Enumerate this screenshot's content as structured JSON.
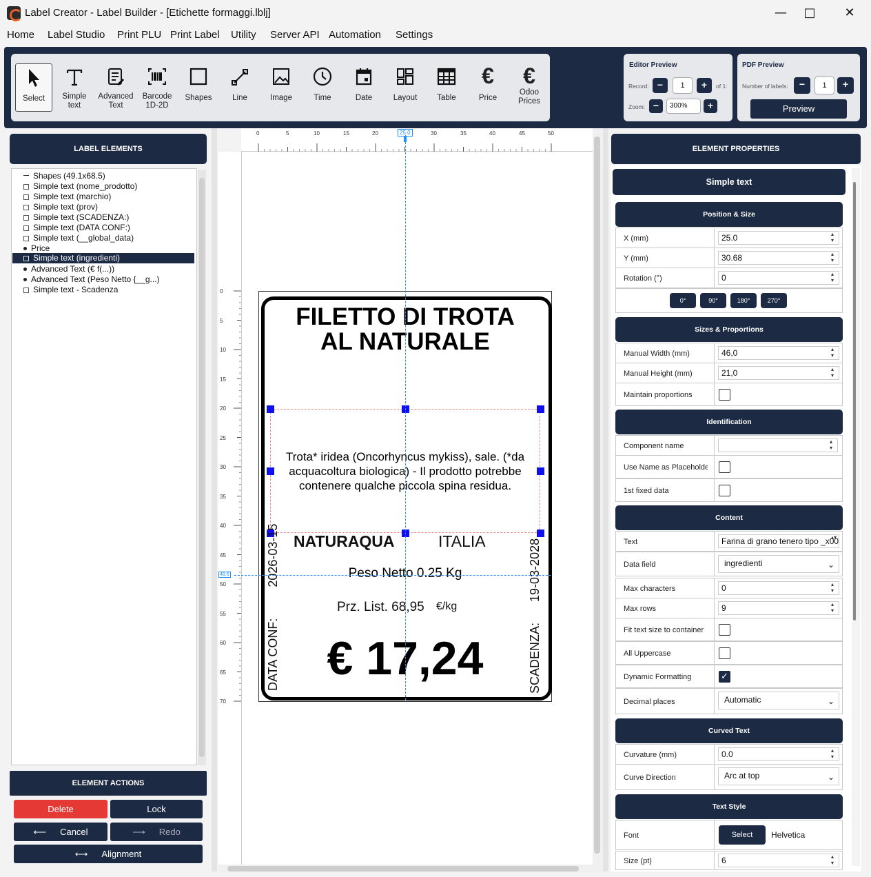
{
  "window": {
    "title": "Label Creator - Label Builder - [Etichette formaggi.lblj]"
  },
  "menu": [
    "Home",
    "Label Studio",
    "Print PLU",
    "Print Label",
    "Utility",
    "Server API",
    "Automation",
    "Settings"
  ],
  "tools": [
    {
      "label": "Select",
      "icon": "cursor-icon"
    },
    {
      "label": "Simple text",
      "icon": "text-icon"
    },
    {
      "label": "Advanced Text",
      "icon": "advanced-text-icon"
    },
    {
      "label": "Barcode 1D-2D",
      "icon": "barcode-icon"
    },
    {
      "label": "Shapes",
      "icon": "square-icon"
    },
    {
      "label": "Line",
      "icon": "line-icon"
    },
    {
      "label": "Image",
      "icon": "image-icon"
    },
    {
      "label": "Time",
      "icon": "clock-icon"
    },
    {
      "label": "Date",
      "icon": "calendar-icon"
    },
    {
      "label": "Layout",
      "icon": "layout-icon"
    },
    {
      "label": "Table",
      "icon": "table-icon"
    },
    {
      "label": "Price",
      "icon": "euro-icon"
    },
    {
      "label": "Odoo Prices",
      "icon": "euro-icon"
    }
  ],
  "editor_preview": {
    "title": "Editor Preview",
    "record_label": "Record:",
    "record_value": "1",
    "of_label": "of 1:",
    "zoom_label": "Zoom:",
    "zoom_value": "300%"
  },
  "pdf_preview": {
    "title": "PDF Preview",
    "labels_label": "Number of labels:",
    "labels_value": "1",
    "preview_button": "Preview"
  },
  "left_panel": {
    "title": "LABEL ELEMENTS",
    "elements": [
      "Shapes (49.1x68.5)",
      "Simple text (nome_prodotto)",
      "Simple text (marchio)",
      "Simple text (prov)",
      "Simple text (SCADENZA:)",
      "Simple text (DATA CONF:)",
      "Simple text (__global_data)",
      "Price",
      "Simple text (ingredienti)",
      "Advanced Text (€  f(...))",
      "Advanced Text (Peso Netto {__g...)",
      "Simple text - Scadenza"
    ],
    "selected_index": 8,
    "actions_title": "ELEMENT ACTIONS",
    "delete": "Delete",
    "lock": "Lock",
    "cancel": "Cancel",
    "redo": "Redo",
    "alignment": "Alignment"
  },
  "ruler": {
    "top": [
      "0",
      "5",
      "10",
      "15",
      "20",
      "25",
      "30",
      "35",
      "40",
      "45",
      "50"
    ],
    "left": [
      "0",
      "5",
      "10",
      "15",
      "20",
      "25",
      "30",
      "35",
      "40",
      "45",
      "50",
      "55",
      "60",
      "65",
      "70"
    ],
    "cursor_x": "25.0",
    "cursor_y": "48.6"
  },
  "label": {
    "title_line1": "FILETTO DI TROTA",
    "title_line2": "AL NATURALE",
    "ingredients": "Trota* iridea (Oncorhyncus mykiss), sale. (*da acquacoltura biologica) - Il prodotto potrebbe contenere qualche piccola spina residua.",
    "brand": "NATURAQUA",
    "origin": "ITALIA",
    "weight": "Peso Netto 0.25 Kg",
    "price_list": "Prz. List. 68,95",
    "price_unit": "€/kg",
    "price": "€ 17,24",
    "left_vertical_label": "DATA CONF:",
    "left_vertical_value": "2026-03-15",
    "right_vertical_label": "SCADENZA:",
    "right_vertical_value": "19-03-2028"
  },
  "right_panel": {
    "title": "ELEMENT PROPERTIES",
    "element_type": "Simple text",
    "position_size": {
      "title": "Position & Size",
      "x_label": "X (mm)",
      "x": "25.0",
      "y_label": "Y (mm)",
      "y": "30.68",
      "rot_label": "Rotation (°)",
      "rot": "0",
      "rot_buttons": [
        "0°",
        "90°",
        "180°",
        "270°"
      ]
    },
    "sizes": {
      "title": "Sizes & Proportions",
      "w_label": "Manual Width (mm)",
      "w": "46,0",
      "h_label": "Manual Height (mm)",
      "h": "21,0",
      "maintain_label": "Maintain proportions"
    },
    "identification": {
      "title": "Identification",
      "name_label": "Component name",
      "name": "",
      "use_name_label": "Use Name as Placeholder",
      "fixed_label": "1st fixed data"
    },
    "content": {
      "title": "Content",
      "text_label": "Text",
      "text": "Farina di grano tenero tipo _x00",
      "field_label": "Data field",
      "field": "ingredienti",
      "maxchar_label": "Max characters",
      "maxchar": "0",
      "maxrows_label": "Max rows",
      "maxrows": "9",
      "fit_label": "Fit text size to container",
      "upper_label": "All Uppercase",
      "dyn_label": "Dynamic Formatting",
      "dec_label": "Decimal places",
      "dec": "Automatic"
    },
    "curved": {
      "title": "Curved Text",
      "curv_label": "Curvature (mm)",
      "curv": "0.0",
      "dir_label": "Curve Direction",
      "dir": "Arc at top"
    },
    "text_style": {
      "title": "Text Style",
      "font_label": "Font",
      "font_button": "Select",
      "font": "Helvetica",
      "size_label": "Size (pt)",
      "size": "6"
    }
  },
  "colors": {
    "navy": "#1d2a44",
    "delete": "#e53935",
    "accent": "#1e90ff"
  }
}
